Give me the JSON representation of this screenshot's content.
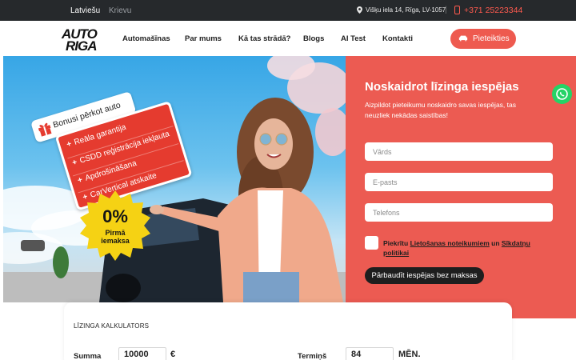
{
  "topbar": {
    "lang_active": "Latviešu",
    "lang_other": "Krievu",
    "address": "Višķu iela 14, Rīga, LV-1057",
    "separator": "|",
    "phone": "+371 25223344"
  },
  "header": {
    "logo_line1": "AUTO",
    "logo_line2": "RIGA",
    "nav": [
      "Automašīnas",
      "Par mums",
      "Kā tas strādā?",
      "Blogs",
      "AI Test",
      "Kontakti"
    ],
    "cta": "Pieteikties"
  },
  "hero": {
    "bonus_title": "Bonusi pērkot auto",
    "bonus_items": [
      "Reāla garantija",
      "CSDD reģistrācija iekļauta",
      "Apdrošināšana",
      "CarVertical atskaite"
    ],
    "badge_value": "0%",
    "badge_label_line1": "Pirmā",
    "badge_label_line2": "iemaksa"
  },
  "form": {
    "title": "Noskaidrot līzinga iespējas",
    "subtitle": "Aizpildot pieteikumu noskaidro savas iespējas, tas neuzliek nekādas saistības!",
    "name_placeholder": "Vārds",
    "email_placeholder": "E-pasts",
    "phone_placeholder": "Telefons",
    "consent_prefix": "Piekrītu",
    "terms_link": "Lietošanas noteikumiem",
    "consent_and": "un",
    "cookies_link": "Sīkdatņu politikai",
    "submit": "Pārbaudīt iespējas bez maksas"
  },
  "calculator": {
    "title": "LĪZINGA KALKULATORS",
    "amount_label": "Summa",
    "amount_value": "10000",
    "amount_unit": "€",
    "term_label": "Termiņš",
    "term_value": "84",
    "term_unit": "MĒN."
  },
  "colors": {
    "accent": "#ec5b52",
    "topbar_bg": "#26292c",
    "phone": "#ff5a4e",
    "whatsapp": "#25d366",
    "badge": "#f5d214"
  }
}
